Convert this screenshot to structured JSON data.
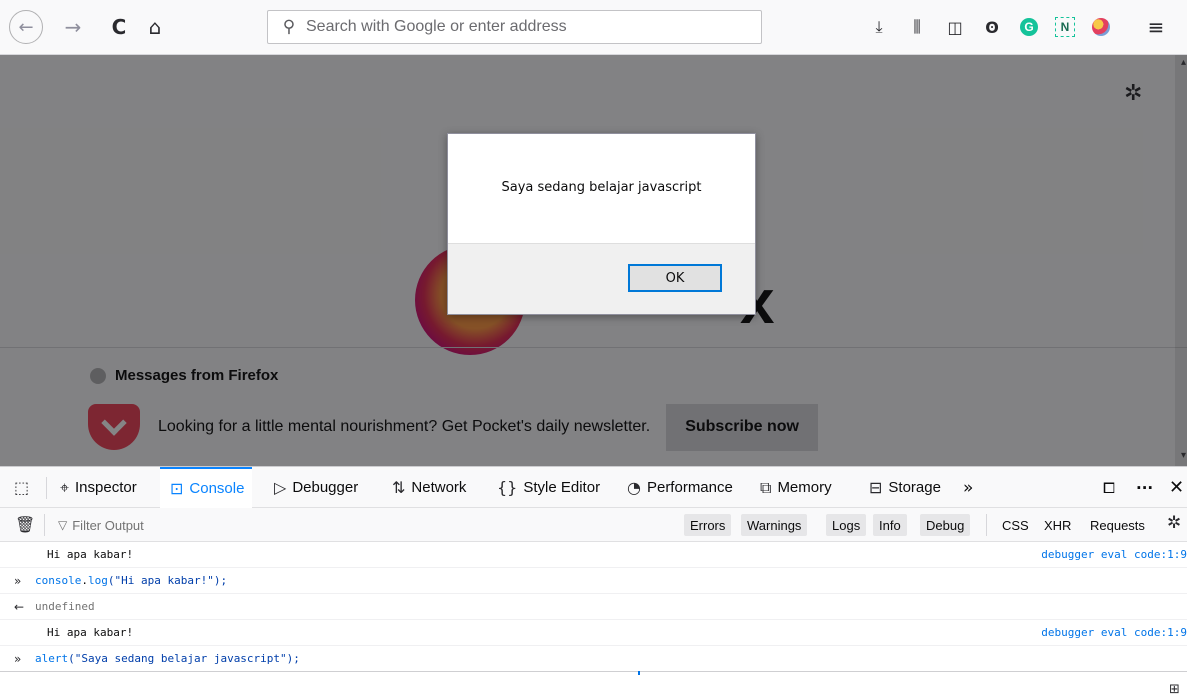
{
  "browser": {
    "nav": {
      "back_icon": "←",
      "forward_icon": "→",
      "reload_icon": "C",
      "home_icon": "⌂"
    },
    "url_bar": {
      "search_icon": "⚲",
      "placeholder": "Search with Google or enter address",
      "value": ""
    },
    "toolbar": {
      "download_icon": "⤓",
      "library_icon": "⫼",
      "sidebar_icon": "◫",
      "account_icon": "ʘ",
      "grammarly_label": "G",
      "notion_label": "N",
      "menu_icon": "≡"
    }
  },
  "newtab": {
    "gear_icon": "✲",
    "wordmark": "x",
    "messages_title": "Messages from Firefox",
    "pocket_text": "Looking for a little mental nourishment? Get Pocket's daily newsletter.",
    "subscribe_label": "Subscribe now",
    "scroll_up": "▴",
    "scroll_down": "▾"
  },
  "alert": {
    "message": "Saya sedang belajar javascript",
    "ok_label": "OK"
  },
  "devtools": {
    "tabs": {
      "picker_icon": "⬚",
      "inspector": {
        "icon": "⌖",
        "label": "Inspector"
      },
      "console": {
        "icon": "⊡",
        "label": "Console"
      },
      "debugger": {
        "icon": "▷",
        "label": "Debugger"
      },
      "network": {
        "icon": "⇅",
        "label": "Network"
      },
      "style_editor": {
        "icon": "{}",
        "label": "Style Editor"
      },
      "performance": {
        "icon": "◔",
        "label": "Performance"
      },
      "memory": {
        "icon": "⧉",
        "label": "Memory"
      },
      "storage": {
        "icon": "⊟",
        "label": "Storage"
      },
      "more_icon": "»",
      "undock_icon": "⧠",
      "dots_icon": "···",
      "close_icon": "✕"
    },
    "filter": {
      "trash_icon": "🗑",
      "funnel_icon": "▽",
      "placeholder": "Filter Output",
      "levels": [
        "Errors",
        "Warnings",
        "Logs",
        "Info",
        "Debug"
      ],
      "types": [
        "CSS",
        "XHR",
        "Requests"
      ],
      "gear_icon": "✲"
    },
    "console_rows": [
      {
        "prefix": "",
        "text": "Hi apa kabar!",
        "source": "debugger eval code:1:9"
      },
      {
        "prefix": "»",
        "code_fn": "console",
        "code_dot": ".",
        "code_method": "log",
        "code_args": "(\"Hi apa kabar!\");",
        "source": ""
      },
      {
        "prefix": "←",
        "text": "undefined",
        "source": ""
      },
      {
        "prefix": "",
        "text": "Hi apa kabar!",
        "source": "debugger eval code:1:9"
      },
      {
        "prefix": "»",
        "code_fn": "alert",
        "code_args": "(\"Saya sedang belajar javascript\");",
        "source": ""
      }
    ],
    "corner_icon": "⊞"
  }
}
